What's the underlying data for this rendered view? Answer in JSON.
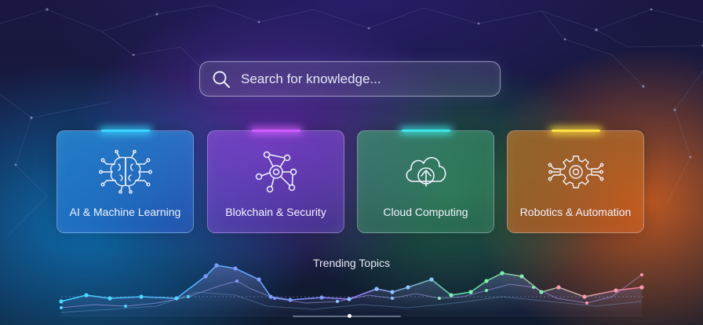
{
  "search": {
    "placeholder": "Search for knowledge..."
  },
  "cards": [
    {
      "label": "AI & Machine Learning",
      "icon": "brain-circuit-icon",
      "accent": "#39d4ff"
    },
    {
      "label": "Blokchain & Security",
      "icon": "blockchain-network-icon",
      "accent": "#d05cff"
    },
    {
      "label": "Cloud Computing",
      "icon": "cloud-upload-icon",
      "accent": "#3ce6e6"
    },
    {
      "label": "Robotics & Automation",
      "icon": "gear-circuit-icon",
      "accent": "#ffe040"
    }
  ],
  "trending": {
    "title": "Trending Topics"
  },
  "colors": {
    "blue": "#1a8fe0",
    "purple": "#7a3fd0",
    "green": "#3aa070",
    "orange": "#e07020"
  }
}
